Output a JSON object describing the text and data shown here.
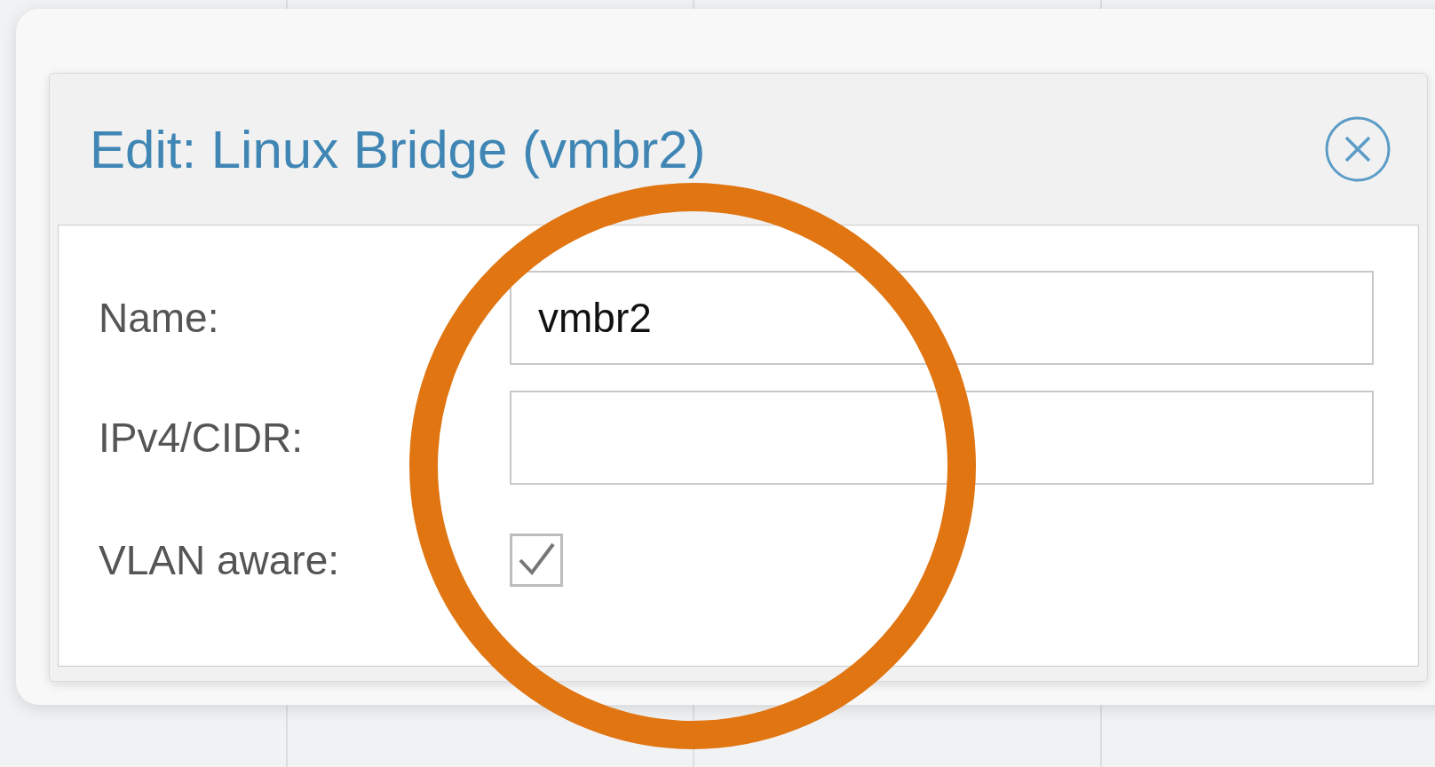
{
  "dialog": {
    "title": "Edit: Linux Bridge (vmbr2)",
    "fields": [
      {
        "kind": "text",
        "label": "Name:",
        "value": "vmbr2"
      },
      {
        "kind": "text",
        "label": "IPv4/CIDR:"
      },
      {
        "kind": "checkbox",
        "label": "VLAN aware:",
        "checked": true
      }
    ]
  }
}
